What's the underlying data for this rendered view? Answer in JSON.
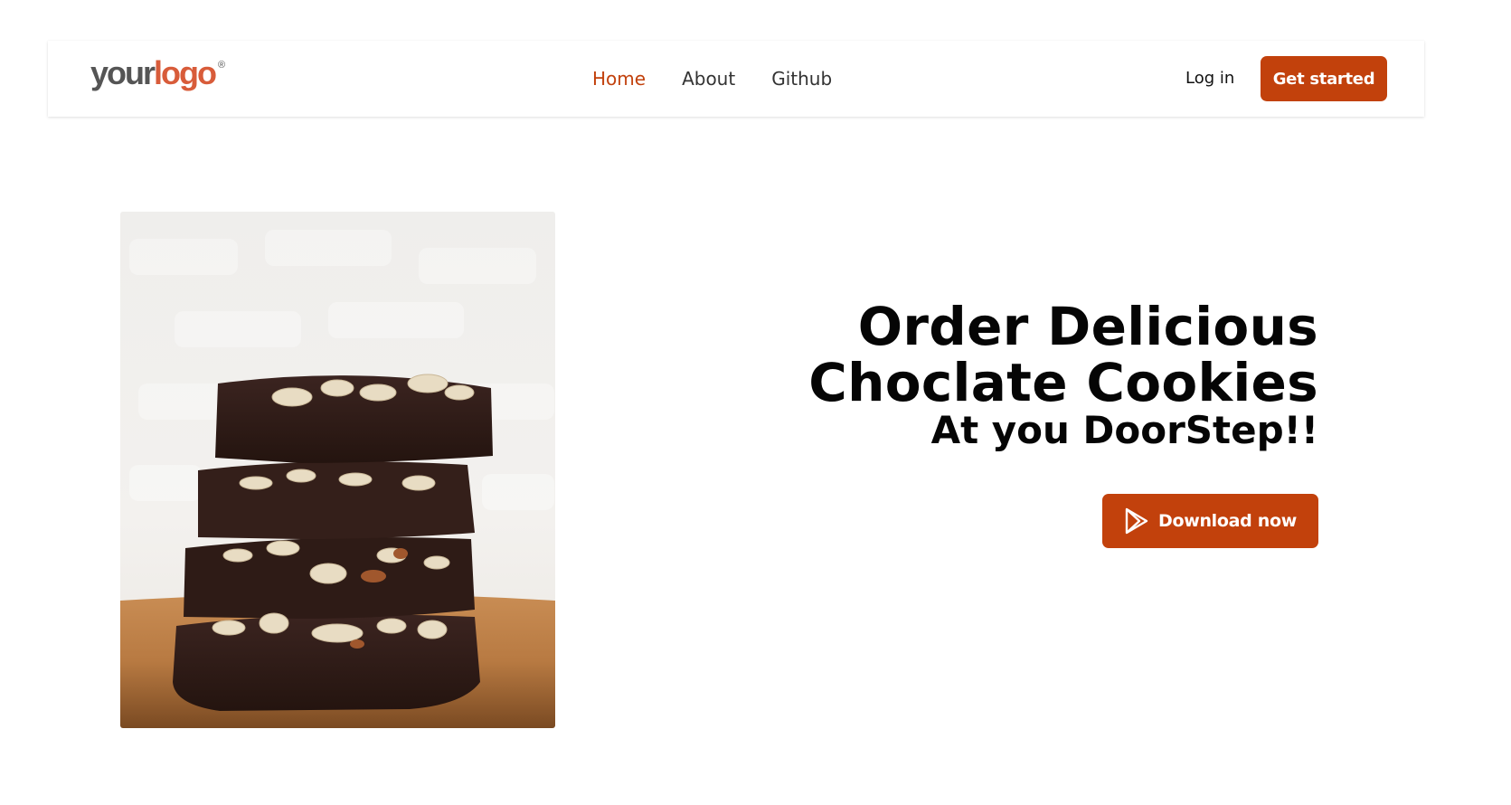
{
  "header": {
    "logo": {
      "text_part1": "your",
      "text_part2": "logo",
      "registered": "®"
    },
    "nav": [
      {
        "label": "Home",
        "active": true
      },
      {
        "label": "About",
        "active": false
      },
      {
        "label": "Github",
        "active": false
      }
    ],
    "login_label": "Log in",
    "get_started_label": "Get started"
  },
  "hero": {
    "image": {
      "icon": "cookie-stack-photo"
    },
    "headline": "Order Delicious Choclate Cookies",
    "subheadline": "At you DoorStep!!",
    "download_label": "Download now",
    "download_icon": "play-store-icon"
  },
  "colors": {
    "accent": "#c2410c",
    "logo_accent": "#d85c3a",
    "logo_gray": "#555555"
  }
}
